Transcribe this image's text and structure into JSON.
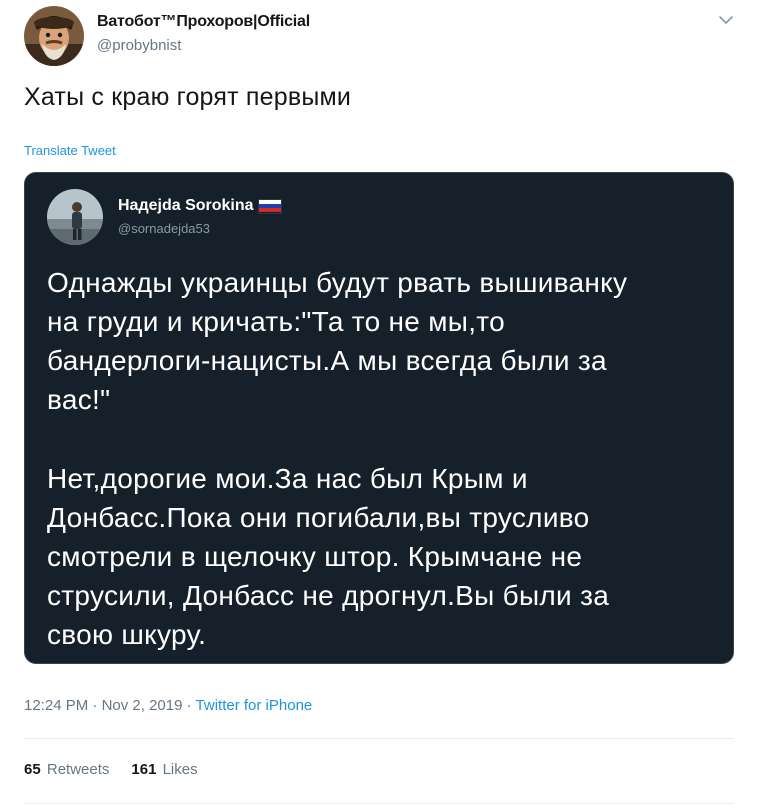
{
  "tweet": {
    "author": {
      "display_name": "Ватобот™Прохоров|Official",
      "handle": "@probybnist",
      "avatar_icon": "avatar-photo"
    },
    "menu_icon": "chevron-down-icon",
    "text": "Хаты с краю горят первыми",
    "translate_label": "Translate Tweet",
    "quote": {
      "author": {
        "display_name": "Надejda Sorokina",
        "handle": "@sornadejda53",
        "flag": "russian-flag",
        "avatar_icon": "avatar-photo"
      },
      "paragraph_1": [
        "Однажды украинцы будут рвать вышиванку",
        "на груди и кричать:\"Та то не мы,то",
        "бандерлоги-нацисты.А мы всегда были за",
        "вас!\""
      ],
      "paragraph_2": [
        "Нет,дорогие мои.За нас был Крым и",
        "Донбасс.Пока они погибали,вы трусливо",
        "смотрели в щелочку штор. Крымчане не",
        "струсили, Донбасс не дрогнул.Вы были за",
        "свою шкуру."
      ]
    },
    "meta": {
      "time": "12:24 PM",
      "date": "Nov 2, 2019",
      "separator": "·",
      "source": "Twitter for iPhone"
    },
    "stats": {
      "retweets_count": "65",
      "retweets_label": "Retweets",
      "likes_count": "161",
      "likes_label": "Likes"
    }
  },
  "colors": {
    "link": "#1b95e0",
    "secondary_text": "#657786",
    "quote_background": "#15202b"
  }
}
